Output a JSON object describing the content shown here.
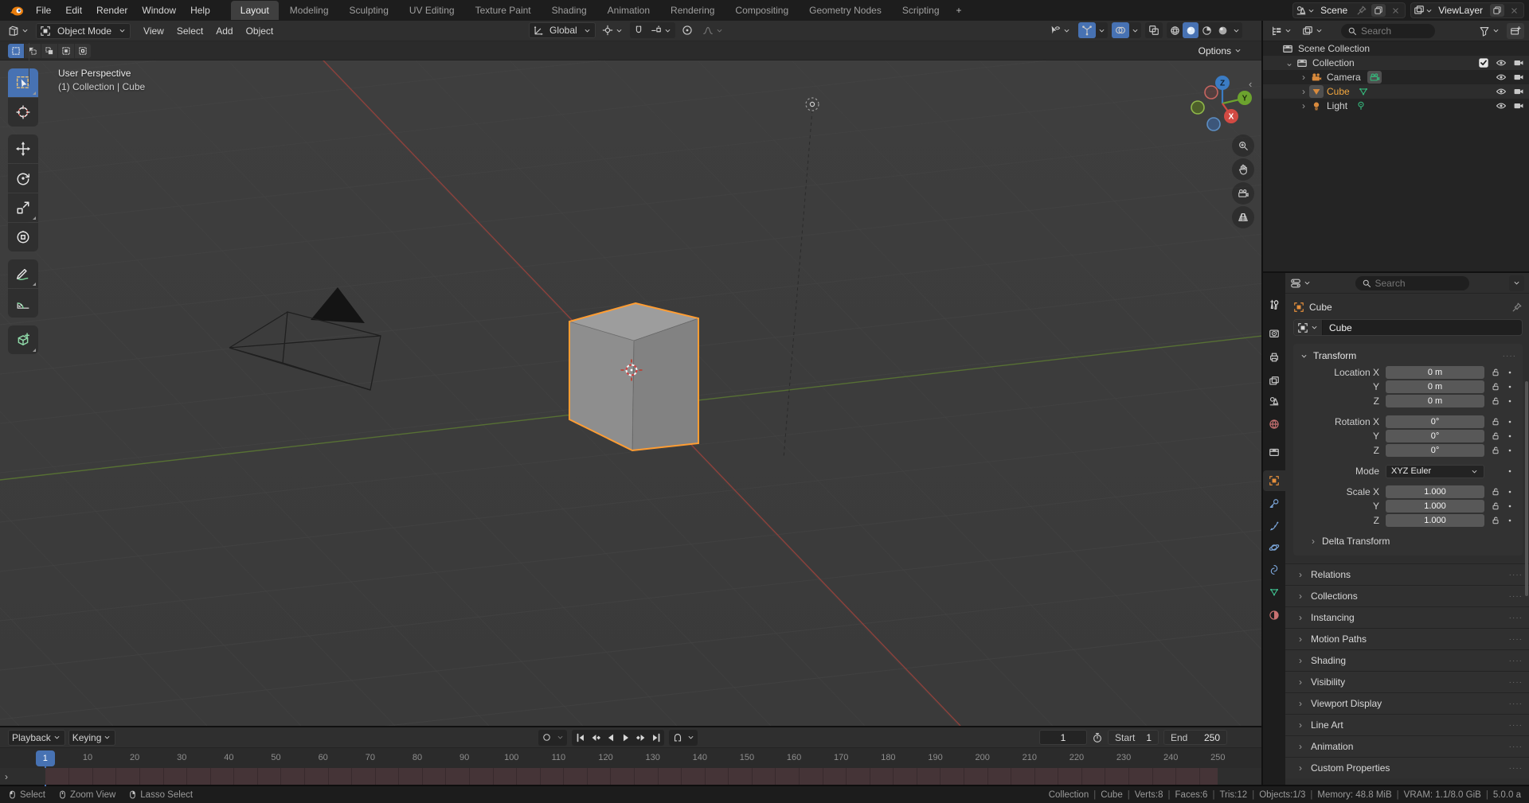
{
  "colors": {
    "accent": "#4772b3",
    "active_object": "#f3a73f",
    "axis_x": "#96423c",
    "axis_y": "#5c7a33",
    "axis_z": "#3b7cc4",
    "cube_outline": "#ff9d33"
  },
  "topbar": {
    "menus": [
      "File",
      "Edit",
      "Render",
      "Window",
      "Help"
    ],
    "tabs": [
      "Layout",
      "Modeling",
      "Sculpting",
      "UV Editing",
      "Texture Paint",
      "Shading",
      "Animation",
      "Rendering",
      "Compositing",
      "Geometry Nodes",
      "Scripting"
    ],
    "active_tab": "Layout",
    "add_tab_label": "+",
    "scene_name": "Scene",
    "view_layer_name": "ViewLayer"
  },
  "viewport_header": {
    "mode": "Object Mode",
    "menus": [
      "View",
      "Select",
      "Add",
      "Object"
    ],
    "orientation": "Global",
    "options_label": "Options"
  },
  "tool_settings": {
    "select_modes": [
      "set",
      "extend",
      "subtract",
      "difference",
      "intersect"
    ],
    "active_mode": "set"
  },
  "toolbar": {
    "tools": [
      {
        "name": "select-box",
        "active": true,
        "sub": true
      },
      {
        "name": "cursor",
        "active": false,
        "sub": false
      },
      {
        "name": "move",
        "active": false,
        "sub": false
      },
      {
        "name": "rotate",
        "active": false,
        "sub": false
      },
      {
        "name": "scale",
        "active": false,
        "sub": true
      },
      {
        "name": "transform",
        "active": false,
        "sub": false
      },
      {
        "name": "annotate",
        "active": false,
        "sub": true
      },
      {
        "name": "measure",
        "active": false,
        "sub": false
      },
      {
        "name": "add-cube",
        "active": false,
        "sub": true
      }
    ],
    "groups": [
      [
        0,
        2
      ],
      [
        2,
        6
      ],
      [
        6,
        8
      ],
      [
        8,
        9
      ]
    ]
  },
  "viewport": {
    "view_label": "User Perspective",
    "context_label": "(1) Collection | Cube",
    "gizmo_axes": {
      "x": "X",
      "y": "Y",
      "z": "Z"
    }
  },
  "outliner": {
    "search_placeholder": "Search",
    "rows": [
      {
        "label": "Scene Collection",
        "icon": "collection",
        "indent": 0,
        "chevron": "",
        "checkbox": false,
        "data_icon": "",
        "active": false,
        "toggles": []
      },
      {
        "label": "Collection",
        "icon": "collection",
        "indent": 1,
        "chevron": "down",
        "checkbox": true,
        "data_icon": "",
        "active": false,
        "toggles": [
          "eye",
          "camera"
        ]
      },
      {
        "label": "Camera",
        "icon": "camera-object",
        "indent": 2,
        "chevron": "right",
        "checkbox": false,
        "data_icon": "camera-data",
        "data_boxed": true,
        "active": false,
        "toggles": [
          "eye",
          "camera"
        ]
      },
      {
        "label": "Cube",
        "icon": "mesh-object",
        "indent": 2,
        "chevron": "right",
        "checkbox": false,
        "data_icon": "mesh-data",
        "icon_boxed": true,
        "active": true,
        "toggles": [
          "eye",
          "camera"
        ]
      },
      {
        "label": "Light",
        "icon": "light-object",
        "indent": 2,
        "chevron": "right",
        "checkbox": false,
        "data_icon": "light-data",
        "active": false,
        "toggles": [
          "eye",
          "camera"
        ]
      }
    ]
  },
  "properties": {
    "search_placeholder": "Search",
    "tabs": [
      {
        "name": "tool",
        "active": false
      },
      {
        "name": "render",
        "active": false
      },
      {
        "name": "output",
        "active": false
      },
      {
        "name": "view-layer",
        "active": false
      },
      {
        "name": "scene",
        "active": false
      },
      {
        "name": "world",
        "active": false
      },
      {
        "name": "collection-props",
        "active": false
      },
      {
        "name": "object",
        "active": true
      },
      {
        "name": "modifiers",
        "active": false
      },
      {
        "name": "particles",
        "active": false
      },
      {
        "name": "physics",
        "active": false
      },
      {
        "name": "constraints",
        "active": false
      },
      {
        "name": "object-data",
        "active": false
      },
      {
        "name": "material",
        "active": false
      }
    ],
    "breadcrumb": "Cube",
    "name_value": "Cube",
    "transform": {
      "title": "Transform",
      "rows": [
        {
          "label": "Location X",
          "value": "0 m",
          "type": "field"
        },
        {
          "label": "Y",
          "value": "0 m",
          "type": "field"
        },
        {
          "label": "Z",
          "value": "0 m",
          "type": "field"
        },
        {
          "label": "Rotation X",
          "value": "0°",
          "type": "field"
        },
        {
          "label": "Y",
          "value": "0°",
          "type": "field"
        },
        {
          "label": "Z",
          "value": "0°",
          "type": "field"
        },
        {
          "label": "Mode",
          "value": "XYZ Euler",
          "type": "dropdown"
        },
        {
          "label": "Scale X",
          "value": "1.000",
          "type": "field"
        },
        {
          "label": "Y",
          "value": "1.000",
          "type": "field"
        },
        {
          "label": "Z",
          "value": "1.000",
          "type": "field"
        }
      ],
      "groups": [
        [
          0,
          3
        ],
        [
          3,
          6
        ],
        [
          6,
          7
        ],
        [
          7,
          10
        ]
      ],
      "subpanel": "Delta Transform"
    },
    "panels": [
      "Relations",
      "Collections",
      "Instancing",
      "Motion Paths",
      "Shading",
      "Visibility",
      "Viewport Display",
      "Line Art",
      "Animation",
      "Custom Properties"
    ]
  },
  "timeline": {
    "playback_label": "Playback",
    "keying_label": "Keying",
    "current_frame": "1",
    "start_label": "Start",
    "start_value": "1",
    "end_label": "End",
    "end_value": "250",
    "ticks": [
      10,
      20,
      30,
      40,
      50,
      60,
      70,
      80,
      90,
      100,
      110,
      120,
      130,
      140,
      150,
      160,
      170,
      180,
      190,
      200,
      210,
      220,
      230,
      240,
      250
    ]
  },
  "statusbar": {
    "hints": [
      {
        "button": "left",
        "label": "Select"
      },
      {
        "button": "middle",
        "label": "Zoom View"
      },
      {
        "button": "right",
        "label": "Lasso Select"
      }
    ],
    "info": [
      "Collection",
      "Cube",
      "Verts:8",
      "Faces:6",
      "Tris:12",
      "Objects:1/3",
      "Memory: 48.8 MiB",
      "VRAM: 1.1/8.0 GiB",
      "5.0.0 a"
    ]
  }
}
